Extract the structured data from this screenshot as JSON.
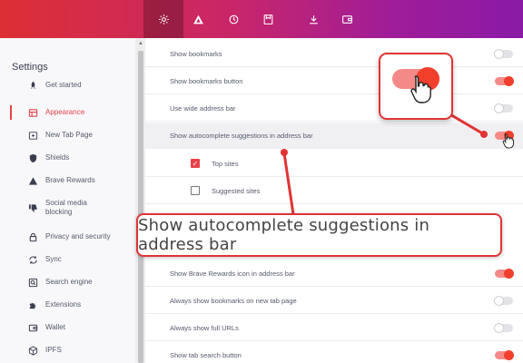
{
  "toolbar": {
    "icons": [
      "gear-icon",
      "triangle-icon",
      "history-icon",
      "bookmark-icon",
      "download-icon",
      "wallet-icon"
    ],
    "active": "gear-icon",
    "accent": "#dc2f34"
  },
  "sidebar": {
    "title": "Settings",
    "items": [
      {
        "label": "Get started",
        "icon": "rocket-icon"
      },
      {
        "label": "Appearance",
        "icon": "appearance-icon",
        "active": true
      },
      {
        "label": "New Tab Page",
        "icon": "new-tab-icon"
      },
      {
        "label": "Shields",
        "icon": "shield-icon"
      },
      {
        "label": "Brave Rewards",
        "icon": "rewards-icon"
      },
      {
        "label": "Social media blocking",
        "icon": "thumbs-down-icon"
      },
      {
        "label": "Privacy and security",
        "icon": "lock-icon"
      },
      {
        "label": "Sync",
        "icon": "sync-icon"
      },
      {
        "label": "Search engine",
        "icon": "search-icon"
      },
      {
        "label": "Extensions",
        "icon": "puzzle-icon"
      },
      {
        "label": "Wallet",
        "icon": "wallet-icon"
      },
      {
        "label": "IPFS",
        "icon": "ipfs-icon"
      }
    ]
  },
  "settings": {
    "rows": [
      {
        "label": "Show bookmarks",
        "on": false
      },
      {
        "label": "Show bookmarks button",
        "on": true
      },
      {
        "label": "Use wide address bar",
        "on": false
      },
      {
        "label": "Show autocomplete suggestions in address bar",
        "on": true
      },
      {
        "label": "Top sites",
        "checked": true
      },
      {
        "label": "Suggested sites",
        "checked": false
      },
      {
        "label": "Show Brave Rewards icon in address bar",
        "on": true
      },
      {
        "label": "Always show bookmarks on new tab page",
        "on": false
      },
      {
        "label": "Always show full URLs",
        "on": false
      },
      {
        "label": "Show tab search button",
        "on": true
      }
    ]
  },
  "callout": {
    "text": "Show autocomplete suggestions in address bar"
  },
  "colors": {
    "toggle_on": "#f23f2c",
    "annotation": "#e03434",
    "active_nav": "#e8424a"
  }
}
